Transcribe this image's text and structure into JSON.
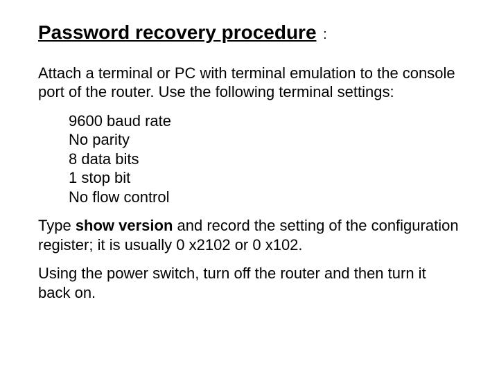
{
  "title": "Password recovery procedure",
  "title_colon": " :",
  "intro": "Attach a terminal or PC with terminal emulation to the console port of the router. Use the following terminal settings:",
  "settings": {
    "s1": "9600 baud rate",
    "s2": "No parity",
    "s3": "8 data bits",
    "s4": "1 stop bit",
    "s5": "No flow control"
  },
  "step2_pre": "Type ",
  "step2_bold": "show version",
  "step2_post": " and record the setting of the configuration register; it is usually 0 x2102 or 0 x102.",
  "step3": "Using the power switch, turn off the router and then turn it back on."
}
